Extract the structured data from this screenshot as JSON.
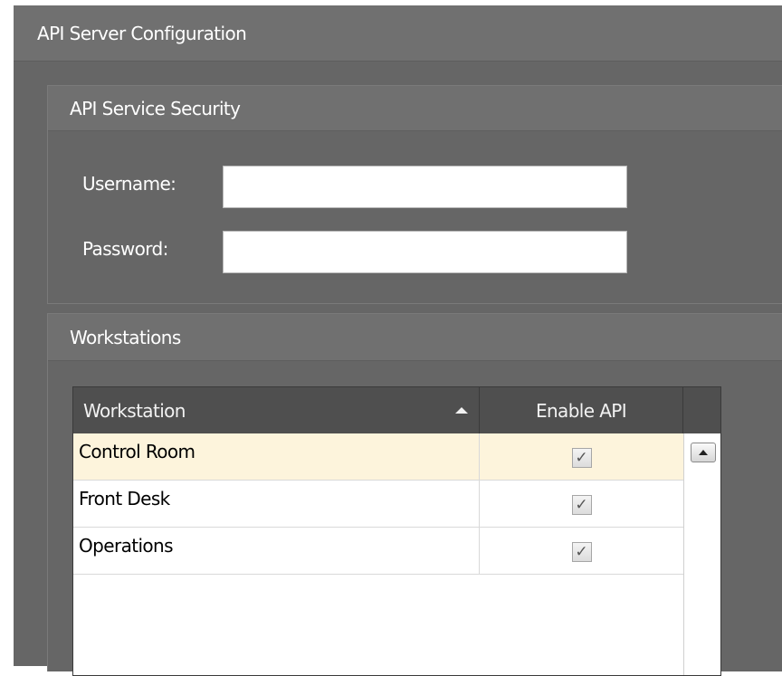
{
  "window": {
    "title": "API Server Configuration"
  },
  "security": {
    "title": "API Service Security",
    "username_label": "Username:",
    "username_value": "",
    "password_label": "Password:",
    "password_value": ""
  },
  "workstations": {
    "title": "Workstations",
    "columns": {
      "workstation": "Workstation",
      "enable_api": "Enable API"
    },
    "sort": {
      "column": "workstation",
      "direction": "ascending"
    },
    "rows": [
      {
        "name": "Control Room",
        "enable_api": true,
        "selected": true
      },
      {
        "name": "Front Desk",
        "enable_api": true,
        "selected": false
      },
      {
        "name": "Operations",
        "enable_api": true,
        "selected": false
      }
    ],
    "check_glyph": "✓"
  },
  "icons": {
    "sort": "sort-ascending-icon",
    "scroll_up": "scroll-up-arrow-icon"
  },
  "colors": {
    "panel_bg": "#666666",
    "header_bg": "#707070",
    "grid_header_bg": "#4f4f4f",
    "selected_row_bg": "#fdf4dc"
  }
}
